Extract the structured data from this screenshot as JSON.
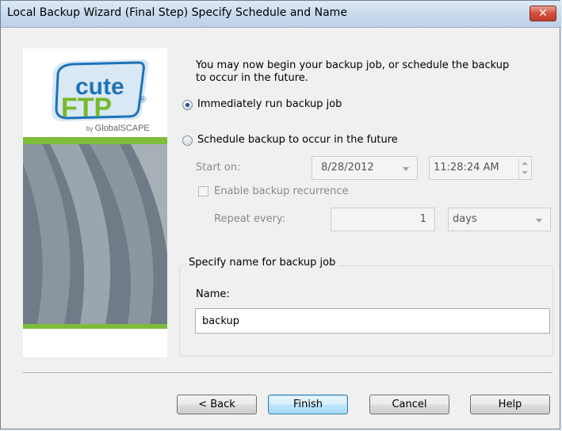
{
  "window": {
    "title": "Local Backup Wizard (Final Step) Specify Schedule and Name",
    "close_glyph": "✕"
  },
  "logo": {
    "line1": "cute",
    "line2": "FTP",
    "registered": "®",
    "by_prefix": "by ",
    "brand": "GlobalSCAPE"
  },
  "intro_text_line1": "You may now begin your backup job, or schedule the backup",
  "intro_text_line2": "to occur in the future.",
  "options": {
    "immediate_label": "Immediately run backup job",
    "schedule_label": "Schedule backup to occur in the future",
    "selected": "immediate"
  },
  "schedule": {
    "start_on_label": "Start on:",
    "start_date": "8/28/2012",
    "start_time": "11:28:24 AM",
    "recurrence_label": "Enable backup recurrence",
    "recurrence_checked": false,
    "repeat_every_label": "Repeat every:",
    "repeat_value": "1",
    "repeat_unit": "days"
  },
  "name_group": {
    "legend": "Specify name for backup job",
    "name_label": "Name:",
    "name_value": "backup"
  },
  "buttons": {
    "back": "< Back",
    "finish": "Finish",
    "cancel": "Cancel",
    "help": "Help"
  },
  "colors": {
    "accent_green": "#7dbd3a",
    "logo_blue": "#1e73b8",
    "logo_green": "#76b82a"
  }
}
